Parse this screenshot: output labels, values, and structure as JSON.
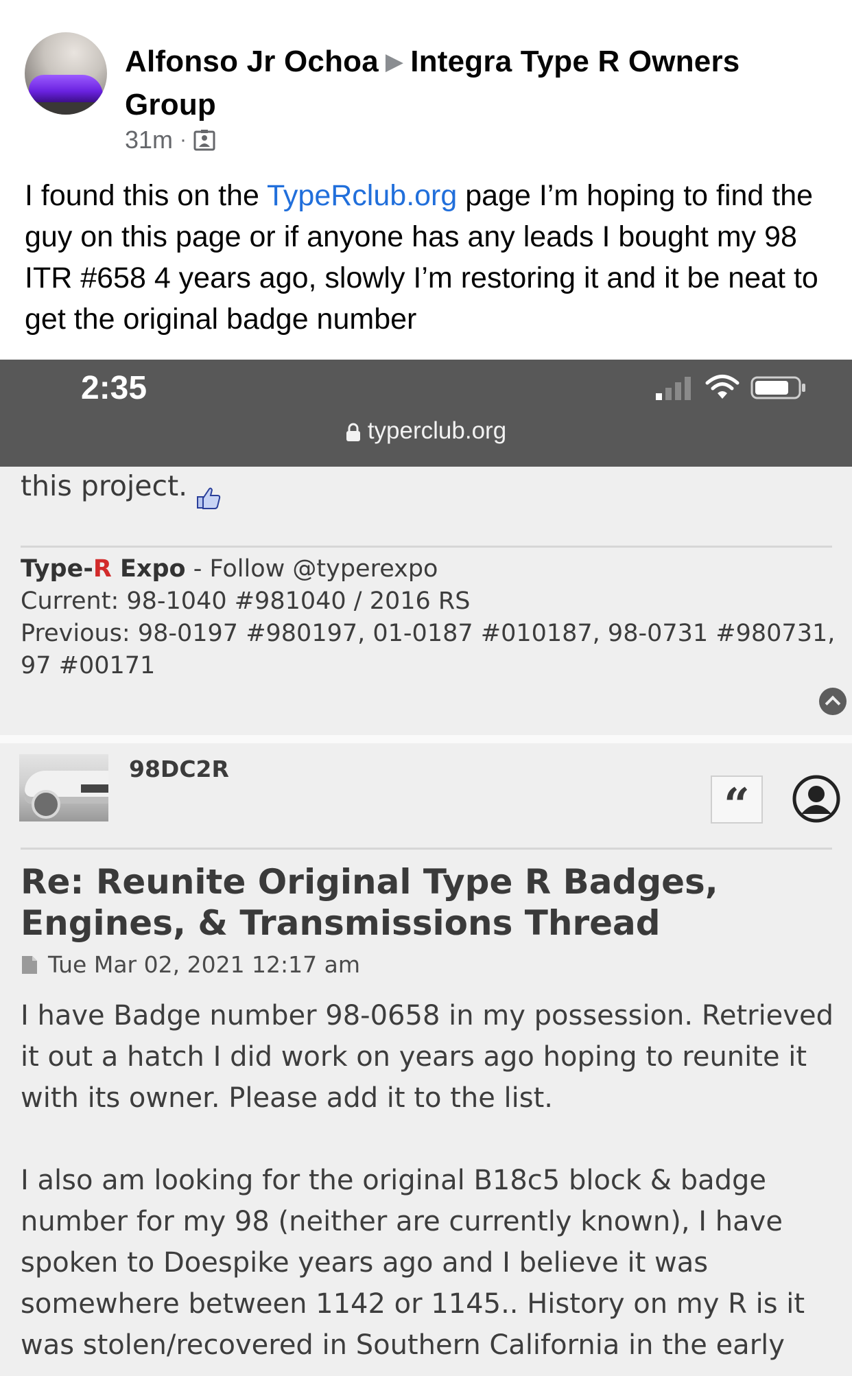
{
  "post": {
    "author": "Alfonso Jr Ochoa",
    "group": "Integra Type R Owners Group",
    "time": "31m",
    "text_before_link": "I found this on the ",
    "link_text": "TypeRclub.org",
    "text_after_link": " page I’m hoping to find the guy on this page or if anyone has any leads I bought my 98 ITR #658 4 years ago, slowly I’m restoring it and it be neat to get the original badge number"
  },
  "screenshot": {
    "status_bar": {
      "time": "2:35",
      "url": "typerclub.org"
    },
    "top_text": "this project.",
    "signature": {
      "brand_prefix": "Type-",
      "brand_red": "R",
      "brand_suffix": " Expo",
      "follow": " - Follow @typerexpo",
      "current": "Current: 98-1040 #981040 / 2016 RS",
      "previous": "Previous: 98-0197 #980197, 01-0187 #010187, 98-0731 #980731, 97 #00171"
    },
    "reply": {
      "username": "98DC2R",
      "quote_glyph": "“",
      "title": "Re: Reunite Original Type R Badges, Engines, & Transmissions Thread",
      "date": "Tue Mar 02, 2021 12:17 am",
      "paragraph1": "I have Badge number 98-0658 in my possession. Retrieved it out a hatch I did work on years ago hoping to reunite it with its owner. Please add it to the list.",
      "paragraph2": "I also am looking for the original B18c5 block & badge number for my 98 (neither are currently known), I have spoken to Doespike years ago and I believe it was somewhere between 1142 or 1145.. History on my R is it was stolen/recovered in Southern California in the early"
    }
  },
  "colors": {
    "link": "#216fdb",
    "status_bar": "#585858",
    "brand_red": "#d22b2b",
    "secondary_text": "#65676b"
  }
}
